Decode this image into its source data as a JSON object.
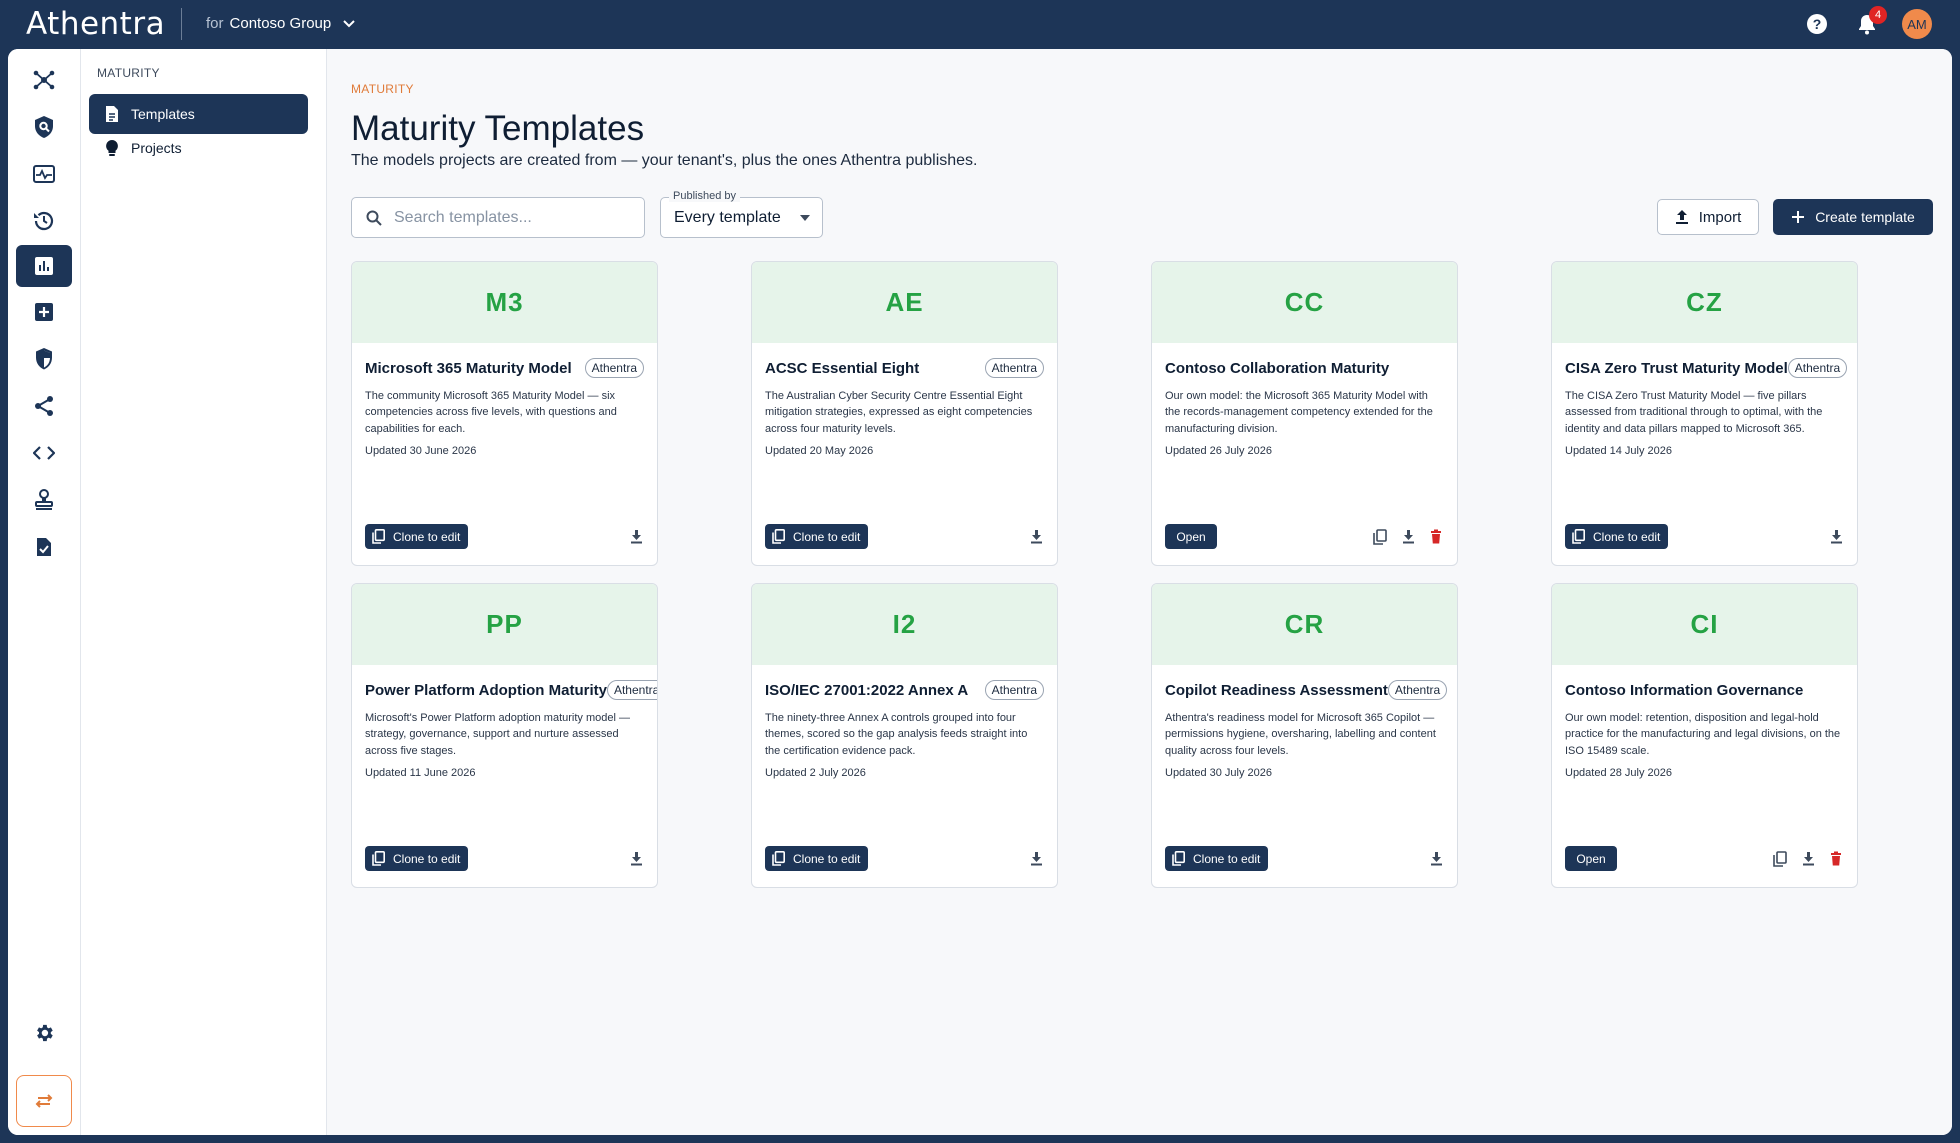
{
  "brand": "Athentra",
  "tenant": {
    "prefix": "for",
    "name": "Contoso Group"
  },
  "notifications": {
    "count": "4"
  },
  "user": {
    "initials": "AM"
  },
  "colors": {
    "navy": "#1d3557",
    "accent": "#f08a4b",
    "banner": "#e6f4ea",
    "banner_text": "#25a244",
    "danger": "#d62828"
  },
  "rail": [
    "network-icon",
    "shield-search-icon",
    "monitor-pulse-icon",
    "history-icon",
    "bar-chart-icon",
    "plus-box-icon",
    "shield-icon",
    "share-icon",
    "code-icon",
    "stamp-icon",
    "clipboard-check-icon",
    "gear-icon",
    "swap-icon"
  ],
  "subnav": {
    "title": "MATURITY",
    "items": [
      {
        "label": "Templates",
        "icon": "document-icon"
      },
      {
        "label": "Projects",
        "icon": "lightbulb-icon"
      }
    ]
  },
  "main": {
    "crumb": "MATURITY",
    "title": "Maturity Templates",
    "subtitle": "The models projects are created from — your tenant's, plus the ones Athentra publishes.",
    "search_placeholder": "Search templates...",
    "filter": {
      "label": "Published by",
      "value": "Every template"
    },
    "import_label": "Import",
    "create_label": "Create template"
  },
  "cards": [
    {
      "code": "M3",
      "title": "Microsoft 365 Maturity Model",
      "publisher": "Athentra",
      "desc": "The community Microsoft 365 Maturity Model — six competencies across five levels, with questions and capabilities for each.",
      "updated": "Updated 30 June 2026",
      "action": "Clone to edit"
    },
    {
      "code": "AE",
      "title": "ACSC Essential Eight",
      "publisher": "Athentra",
      "desc": "The Australian Cyber Security Centre Essential Eight mitigation strategies, expressed as eight competencies across four maturity levels.",
      "updated": "Updated 20 May 2026",
      "action": "Clone to edit"
    },
    {
      "code": "CC",
      "title": "Contoso Collaboration Maturity",
      "publisher": "",
      "desc": "Our own model: the Microsoft 365 Maturity Model with the records-management competency extended for the manufacturing division.",
      "updated": "Updated 26 July 2026",
      "action": "Open"
    },
    {
      "code": "CZ",
      "title": "CISA Zero Trust Maturity Model",
      "publisher": "Athentra",
      "desc": "The CISA Zero Trust Maturity Model — five pillars assessed from traditional through to optimal, with the identity and data pillars mapped to Microsoft 365.",
      "updated": "Updated 14 July 2026",
      "action": "Clone to edit"
    },
    {
      "code": "PP",
      "title": "Power Platform Adoption Maturity",
      "publisher": "Athentra",
      "desc": "Microsoft's Power Platform adoption maturity model — strategy, governance, support and nurture assessed across five stages.",
      "updated": "Updated 11 June 2026",
      "action": "Clone to edit"
    },
    {
      "code": "I2",
      "title": "ISO/IEC 27001:2022 Annex A",
      "publisher": "Athentra",
      "desc": "The ninety-three Annex A controls grouped into four themes, scored so the gap analysis feeds straight into the certification evidence pack.",
      "updated": "Updated 2 July 2026",
      "action": "Clone to edit"
    },
    {
      "code": "CR",
      "title": "Copilot Readiness Assessment",
      "publisher": "Athentra",
      "desc": "Athentra's readiness model for Microsoft 365 Copilot — permissions hygiene, oversharing, labelling and content quality across four levels.",
      "updated": "Updated 30 July 2026",
      "action": "Clone to edit"
    },
    {
      "code": "CI",
      "title": "Contoso Information Governance",
      "publisher": "",
      "desc": "Our own model: retention, disposition and legal-hold practice for the manufacturing and legal divisions, on the ISO 15489 scale.",
      "updated": "Updated 28 July 2026",
      "action": "Open"
    }
  ]
}
